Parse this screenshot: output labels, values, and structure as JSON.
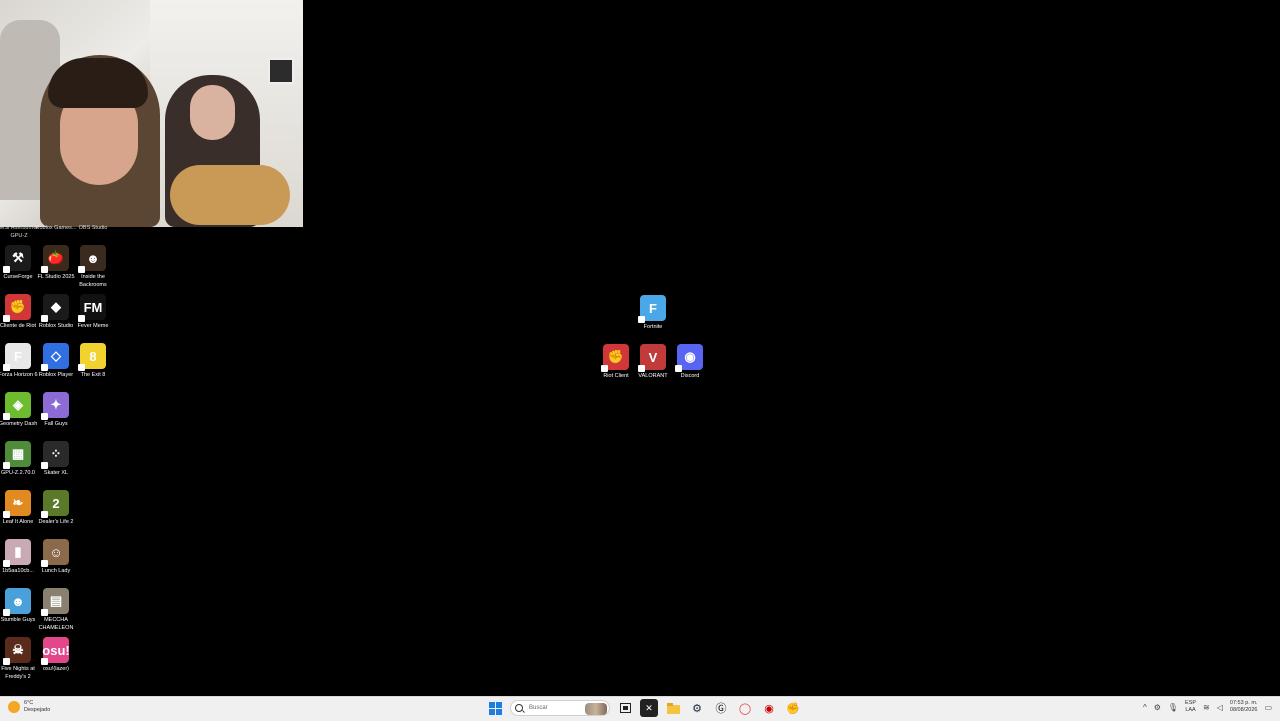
{
  "desktop": {
    "cut_labels": [
      "MSI Afterburner GPU-Z",
      "Roblox Games...",
      "OBS Studio"
    ],
    "left_icons": [
      {
        "label": "CurseForge",
        "color": "#1b1b1b",
        "glyph": "⚒",
        "name": "curseforge-icon"
      },
      {
        "label": "FL Studio 2025",
        "color": "#3a2a1a",
        "glyph": "🍅",
        "name": "fl-studio-icon"
      },
      {
        "label": "Inside the Backrooms",
        "color": "#3b2a1e",
        "glyph": "☻",
        "name": "inside-the-backrooms-icon"
      },
      {
        "label": "Cliente de Riot",
        "color": "#d13639",
        "glyph": "✊",
        "name": "riot-client-icon"
      },
      {
        "label": "Roblox Studio",
        "color": "#1a1a1a",
        "glyph": "◆",
        "name": "roblox-studio-icon"
      },
      {
        "label": "Fever Meme",
        "color": "#111111",
        "glyph": "FM",
        "name": "fever-meme-icon"
      },
      {
        "label": "Forza Horizon 6",
        "color": "#e8e8e8",
        "glyph": "F",
        "name": "forza-horizon-icon"
      },
      {
        "label": "Roblox Player",
        "color": "#2f6fe0",
        "glyph": "◇",
        "name": "roblox-player-icon"
      },
      {
        "label": "The Exit 8",
        "color": "#f2d22e",
        "glyph": "8",
        "name": "the-exit-8-icon"
      },
      {
        "label": "Geometry Dash",
        "color": "#6dbb2f",
        "glyph": "◈",
        "name": "geometry-dash-icon"
      },
      {
        "label": "Fall Guys",
        "color": "#8c6bd6",
        "glyph": "✦",
        "name": "fall-guys-icon"
      },
      {
        "label": "GPU-Z.2.70.0",
        "color": "#4f8c3a",
        "glyph": "▦",
        "name": "gpu-z-icon"
      },
      {
        "label": "Skater XL",
        "color": "#2a2a2a",
        "glyph": "⁘",
        "name": "skater-xl-icon"
      },
      {
        "label": "Leaf It Alone",
        "color": "#e08a1f",
        "glyph": "❧",
        "name": "leaf-it-alone-icon"
      },
      {
        "label": "Dealer's Life 2",
        "color": "#5a7a2a",
        "glyph": "2",
        "name": "dealers-life-icon"
      },
      {
        "label": "1b5aa10cb...",
        "color": "#c9a9b3",
        "glyph": "▮",
        "name": "file-icon"
      },
      {
        "label": "Lunch Lady",
        "color": "#8a6a4a",
        "glyph": "☺",
        "name": "lunch-lady-icon"
      },
      {
        "label": "Stumble Guys",
        "color": "#4aa0d8",
        "glyph": "☻",
        "name": "stumble-guys-icon"
      },
      {
        "label": "MECCHA CHAMELEON",
        "color": "#8a8070",
        "glyph": "▤",
        "name": "meccha-chameleon-icon"
      },
      {
        "label": "Five Nights at Freddy's 2",
        "color": "#5a2a1a",
        "glyph": "☠",
        "name": "fnaf2-icon"
      },
      {
        "label": "osu!(lazer)",
        "color": "#e2478c",
        "glyph": "osu!",
        "name": "osu-icon"
      }
    ],
    "center_icons": [
      {
        "label": "Fortnite",
        "color": "#4aa8e8",
        "glyph": "F",
        "name": "fortnite-icon"
      },
      {
        "label": "Riot Client",
        "color": "#d13639",
        "glyph": "✊",
        "name": "riot-client-center-icon"
      },
      {
        "label": "VALORANT",
        "color": "#c23b3b",
        "glyph": "V",
        "name": "valorant-icon"
      },
      {
        "label": "Discord",
        "color": "#5865f2",
        "glyph": "◉",
        "name": "discord-icon"
      }
    ]
  },
  "taskbar": {
    "weather_temp": "6°C",
    "weather_desc": "Despejado",
    "search_placeholder": "Buscar",
    "lang_line1": "ESP",
    "lang_line2": "LAA",
    "time": "07:53 p. m.",
    "date": "08/08/2026"
  }
}
